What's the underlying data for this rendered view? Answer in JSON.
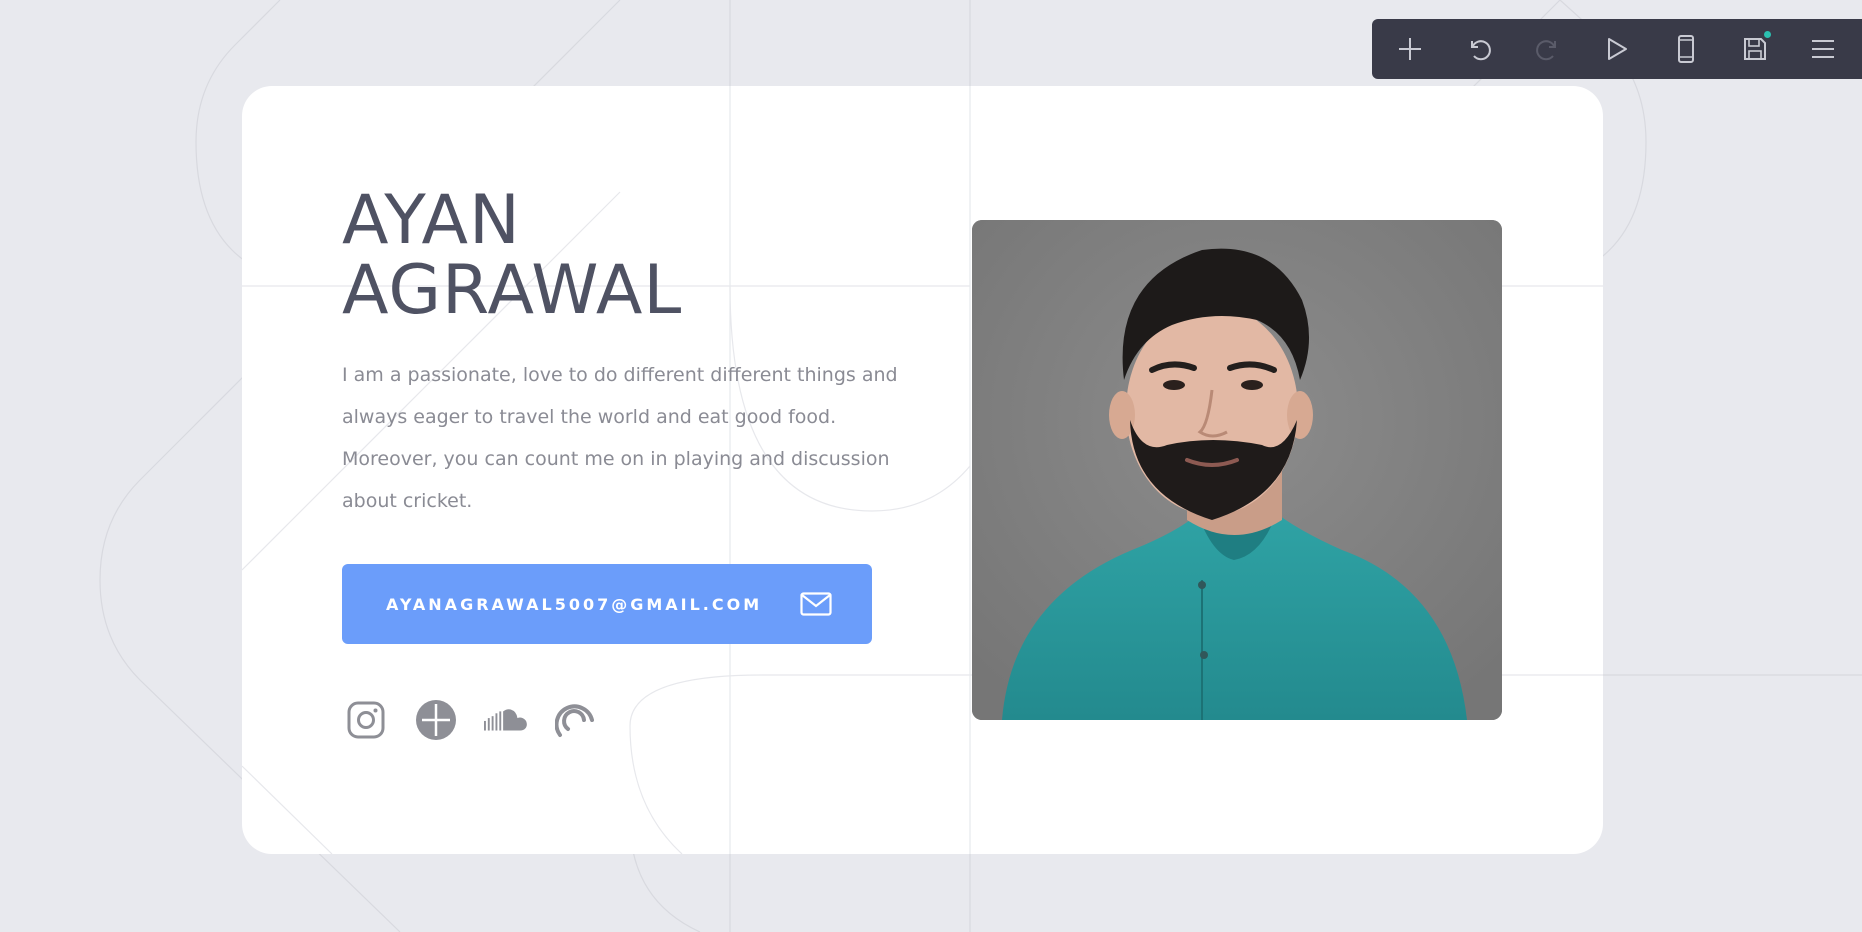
{
  "profile": {
    "first_name": "AYAN",
    "last_name": "AGRAWAL",
    "bio": "I am a passionate, love to do different different things and always eager to travel the world and eat good food. Moreover, you can count me on in playing and discussion about cricket.",
    "email_label": "AYANAGRAWAL5007@GMAIL.COM",
    "email_icon": "mail-icon"
  },
  "socials": [
    {
      "icon": "instagram-icon"
    },
    {
      "icon": "dribbble-icon"
    },
    {
      "icon": "soundcloud-icon"
    },
    {
      "icon": "pocket-casts-icon"
    }
  ],
  "photo": {
    "subject": "portrait-photo"
  },
  "toolbar": {
    "items": [
      {
        "icon": "plus-icon"
      },
      {
        "icon": "undo-icon"
      },
      {
        "icon": "redo-icon",
        "disabled": true
      },
      {
        "icon": "play-icon"
      },
      {
        "icon": "mobile-icon"
      },
      {
        "icon": "save-icon",
        "indicator": true
      },
      {
        "icon": "menu-icon"
      }
    ]
  },
  "colors": {
    "background": "#e8e9ee",
    "card": "#ffffff",
    "heading": "#4f5263",
    "body_text": "#8a8b94",
    "accent": "#6b9dfa",
    "toolbar": "#393a48",
    "indicator": "#2bc0b0"
  }
}
